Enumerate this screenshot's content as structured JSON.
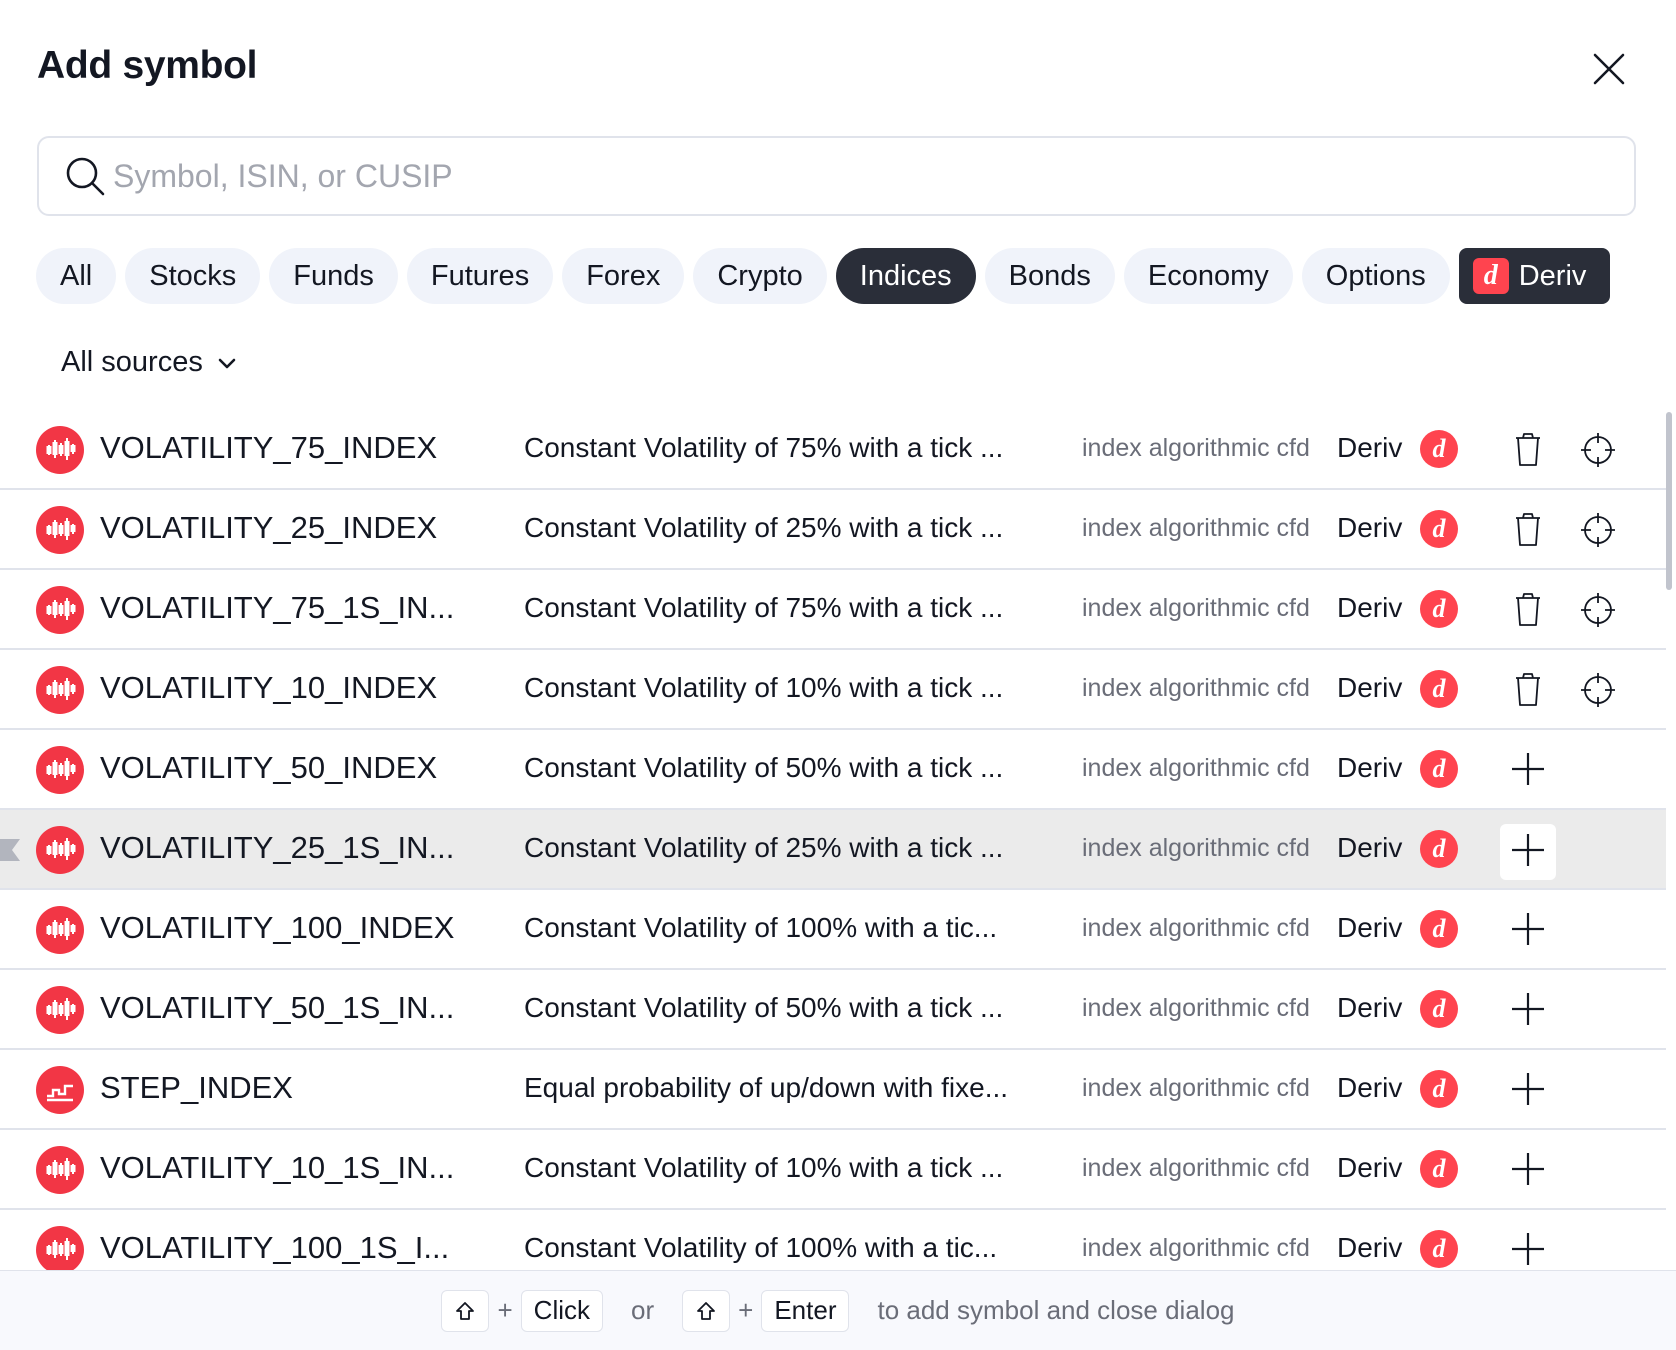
{
  "dialog": {
    "title": "Add symbol",
    "search": {
      "placeholder": "Symbol, ISIN, or CUSIP",
      "value": ""
    },
    "tabs": [
      {
        "label": "All"
      },
      {
        "label": "Stocks"
      },
      {
        "label": "Funds"
      },
      {
        "label": "Futures"
      },
      {
        "label": "Forex"
      },
      {
        "label": "Crypto"
      },
      {
        "label": "Indices"
      },
      {
        "label": "Bonds"
      },
      {
        "label": "Economy"
      },
      {
        "label": "Options"
      },
      {
        "label": "Deriv"
      }
    ],
    "active_tab": "Indices",
    "sources_label": "All sources",
    "rows": [
      {
        "symbol": "VOLATILITY_75_INDEX",
        "description": "Constant Volatility of 75% with a tick ...",
        "type": "index algorithmic cfd",
        "exchange": "Deriv",
        "icon": "candles-icon",
        "added": true
      },
      {
        "symbol": "VOLATILITY_25_INDEX",
        "description": "Constant Volatility of 25% with a tick ...",
        "type": "index algorithmic cfd",
        "exchange": "Deriv",
        "icon": "candles-icon",
        "added": true
      },
      {
        "symbol": "VOLATILITY_75_1S_IN...",
        "description": "Constant Volatility of 75% with a tick ...",
        "type": "index algorithmic cfd",
        "exchange": "Deriv",
        "icon": "candles-icon",
        "added": true
      },
      {
        "symbol": "VOLATILITY_10_INDEX",
        "description": "Constant Volatility of 10% with a tick ...",
        "type": "index algorithmic cfd",
        "exchange": "Deriv",
        "icon": "candles-icon",
        "added": true
      },
      {
        "symbol": "VOLATILITY_50_INDEX",
        "description": "Constant Volatility of 50% with a tick ...",
        "type": "index algorithmic cfd",
        "exchange": "Deriv",
        "icon": "candles-icon",
        "added": false
      },
      {
        "symbol": "VOLATILITY_25_1S_IN...",
        "description": "Constant Volatility of 25% with a tick ...",
        "type": "index algorithmic cfd",
        "exchange": "Deriv",
        "icon": "candles-icon",
        "added": false,
        "hovered": true
      },
      {
        "symbol": "VOLATILITY_100_INDEX",
        "description": "Constant Volatility of 100% with a tic...",
        "type": "index algorithmic cfd",
        "exchange": "Deriv",
        "icon": "candles-icon",
        "added": false
      },
      {
        "symbol": "VOLATILITY_50_1S_IN...",
        "description": "Constant Volatility of 50% with a tick ...",
        "type": "index algorithmic cfd",
        "exchange": "Deriv",
        "icon": "candles-icon",
        "added": false
      },
      {
        "symbol": "STEP_INDEX",
        "description": "Equal probability of up/down with fixe...",
        "type": "index algorithmic cfd",
        "exchange": "Deriv",
        "icon": "step-chart-icon",
        "added": false
      },
      {
        "symbol": "VOLATILITY_10_1S_IN...",
        "description": "Constant Volatility of 10% with a tick ...",
        "type": "index algorithmic cfd",
        "exchange": "Deriv",
        "icon": "candles-icon",
        "added": false
      },
      {
        "symbol": "VOLATILITY_100_1S_I...",
        "description": "Constant Volatility of 100% with a tic...",
        "type": "index algorithmic cfd",
        "exchange": "Deriv",
        "icon": "candles-icon",
        "added": false
      }
    ],
    "footer": {
      "key_click": "Click",
      "or_text": "or",
      "key_enter": "Enter",
      "plus_text": "+",
      "hint": "to add symbol and close dialog"
    },
    "colors": {
      "accent_red": "#f23645",
      "deriv_red": "#ff444f",
      "active_tab_bg": "#2a2e39",
      "tab_bg": "#f0f3fa",
      "hover_row_bg": "#ebebeb"
    }
  }
}
